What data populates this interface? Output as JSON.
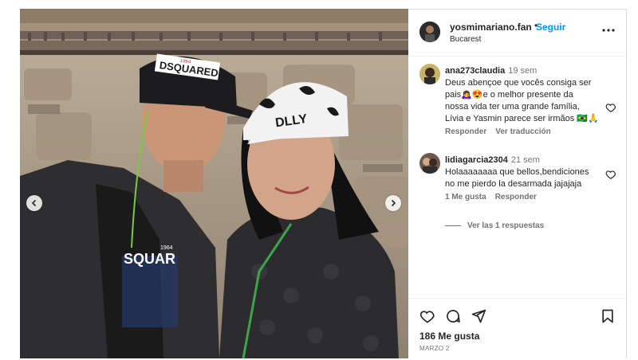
{
  "post": {
    "username": "yosmimariano.fan",
    "follow_label": "Seguir",
    "separator": "•",
    "location": "Bucarest",
    "likes": "186 Me gusta",
    "date": "MARZO 2"
  },
  "photo": {
    "cap_text": "DSQUARED",
    "cap_badge": "1964",
    "shirt_text": "SQUAR",
    "shirt_year": "1964",
    "cap2_text": "DLLY"
  },
  "comments": [
    {
      "username": "ana273claudia",
      "time": "19 sem",
      "line1": "Deus abençoe que vocês consiga ser",
      "line2": "pais🙇‍♀️😍e o melhor presente da",
      "line3": "nossa vida ter uma grande família,",
      "line4": "Lívia e Yasmin parece ser irmãos 🇧🇷🙏",
      "reply_label": "Responder",
      "translate_label": "Ver traducción"
    },
    {
      "username": "lidiagarcia2304",
      "time": "21 sem",
      "line1": "Holaaaaaaaa que bellos,bendiciones",
      "line2": "no me pierdo la desarmada jajajaja",
      "likes_label": "1 Me gusta",
      "reply_label": "Responder",
      "view_replies": "Ver las 1 respuestas"
    }
  ],
  "colors": {
    "link_blue": "#0095f6",
    "text": "#262626",
    "muted": "#737373"
  }
}
